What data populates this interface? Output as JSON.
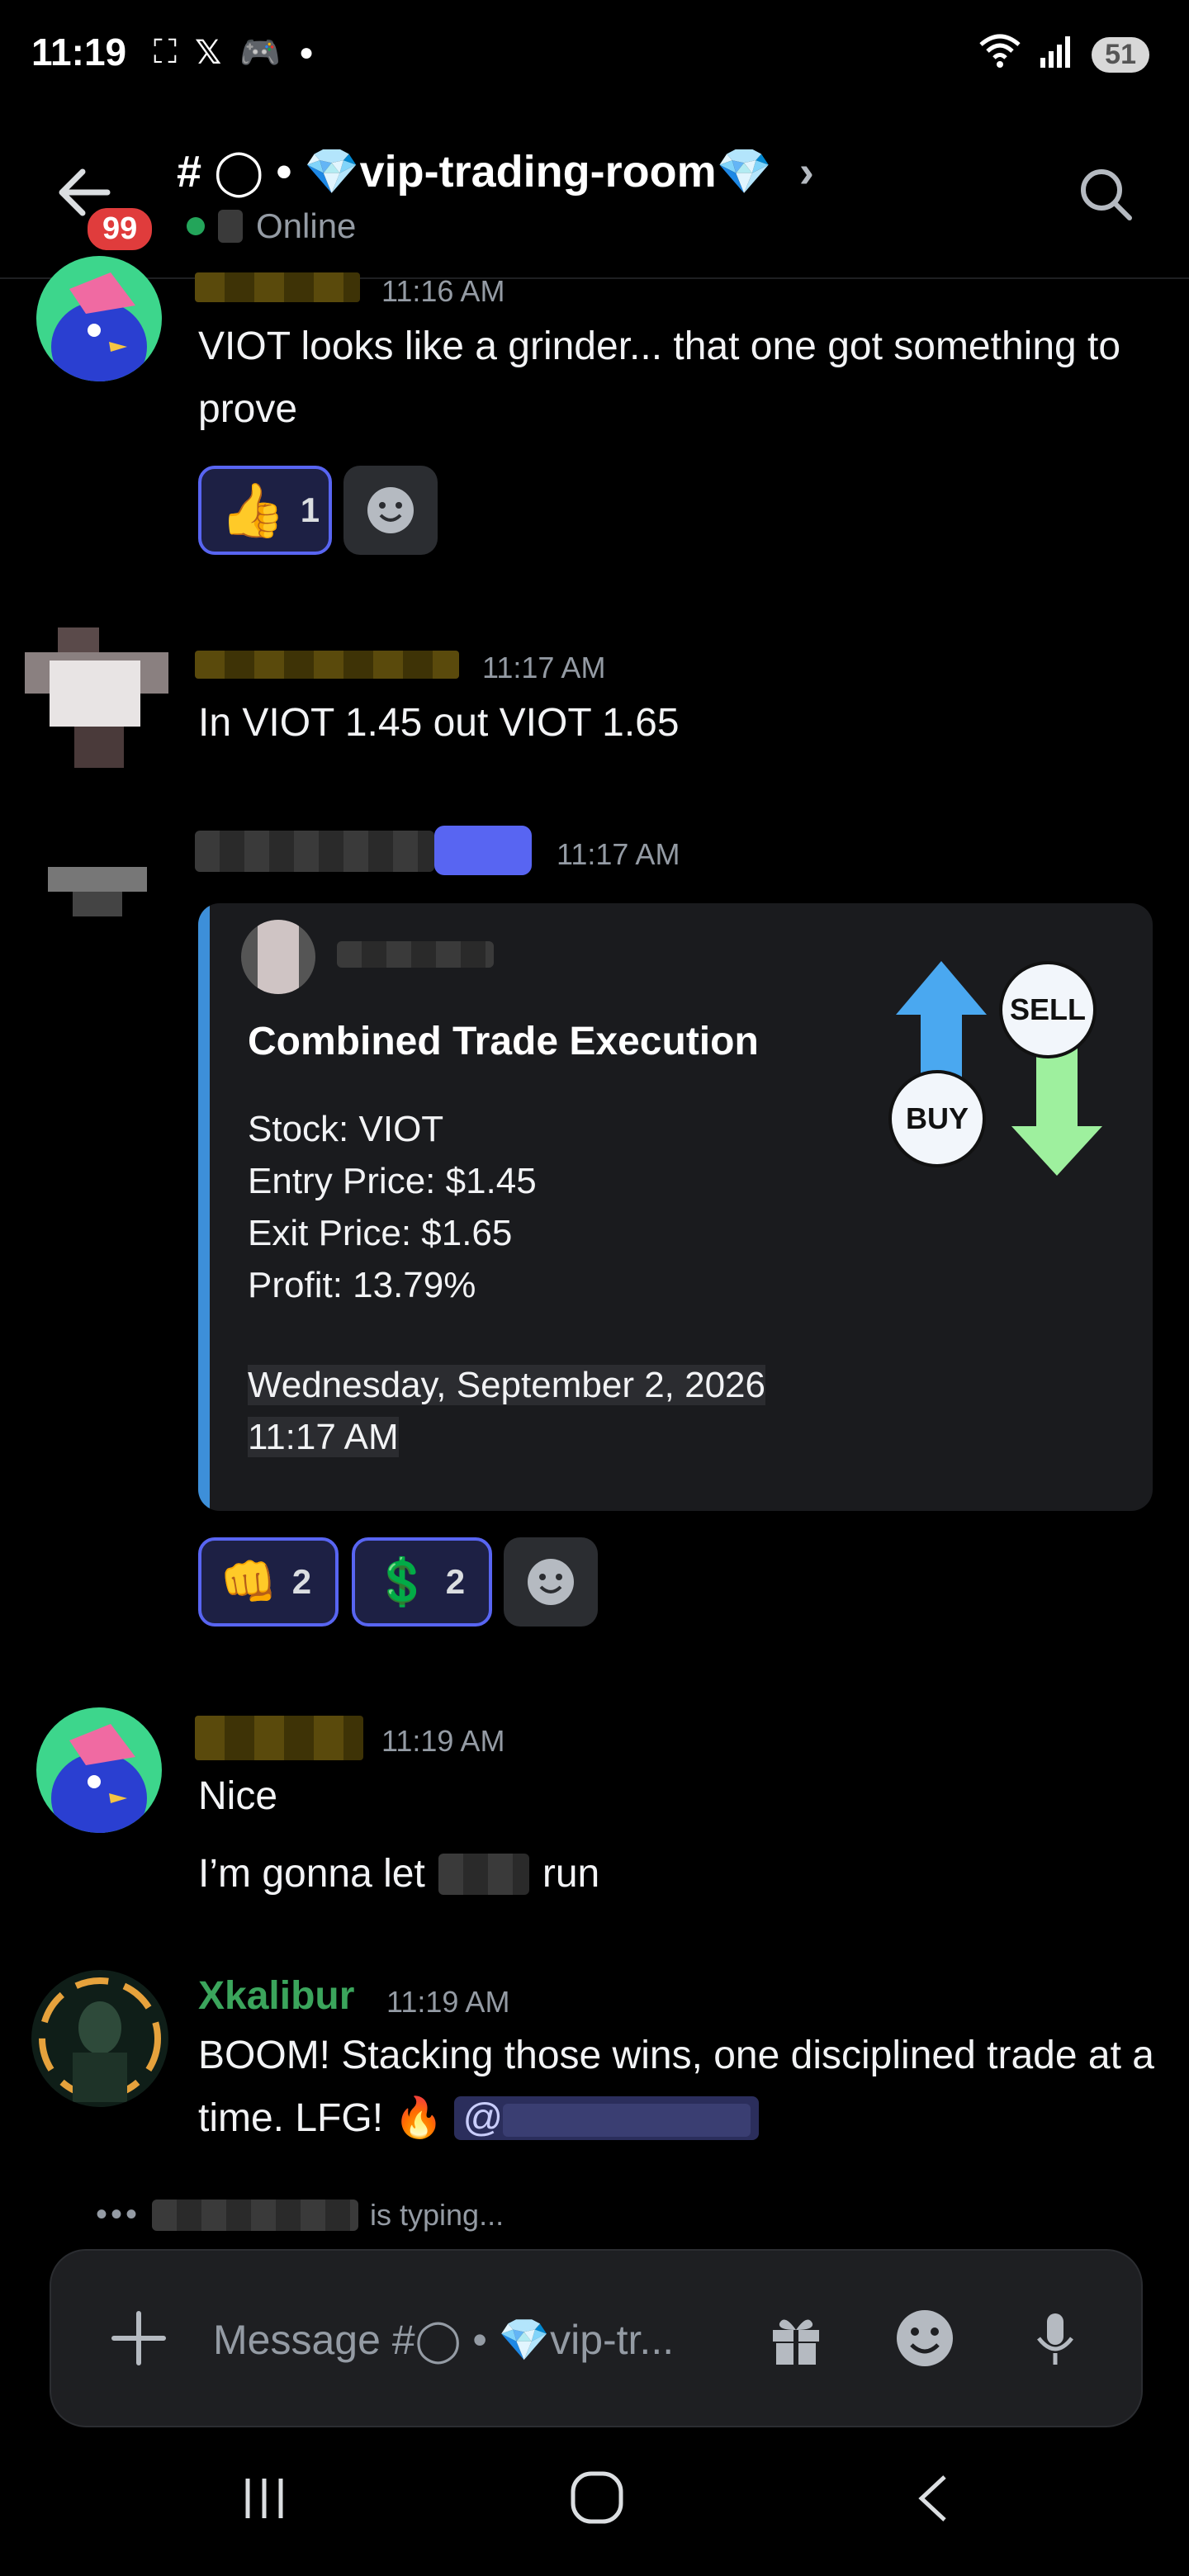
{
  "status_bar": {
    "time": "11:19",
    "battery": "51"
  },
  "header": {
    "unread_badge": "99",
    "channel_name": "# ◯ • 💎vip-trading-room💎",
    "chevron": "›",
    "status": "Online"
  },
  "messages": [
    {
      "timestamp": "11:16 AM",
      "text": "VIOT looks like a grinder... that one got something to prove",
      "reactions": [
        {
          "emoji": "👍",
          "count": "1"
        }
      ]
    },
    {
      "timestamp": "11:17 AM",
      "text": "In VIOT 1.45 out VIOT 1.65"
    },
    {
      "timestamp": "11:17 AM",
      "embed": {
        "title": "Combined Trade Execution",
        "lines": [
          "Stock: VIOT",
          "Entry Price: $1.45",
          "Exit Price: $1.65",
          "Profit: 13.79%"
        ],
        "date": "Wednesday, September 2, 2026",
        "time": "11:17 AM",
        "thumb_sell": "SELL",
        "thumb_buy": "BUY"
      },
      "reactions": [
        {
          "emoji": "👊",
          "count": "2"
        },
        {
          "emoji": "💲",
          "count": "2"
        }
      ]
    },
    {
      "timestamp": "11:19 AM",
      "line1": "Nice",
      "line2_start": "I’m gonna let",
      "line2_end": "run"
    },
    {
      "author": "Xkalibur",
      "timestamp": "11:19 AM",
      "text": "BOOM! Stacking those wins, one disciplined trade at a time. LFG! 🔥",
      "mention_at": "@"
    }
  ],
  "typing": {
    "dots": "•••",
    "suffix": "is typing..."
  },
  "composer": {
    "placeholder": "Message #◯ • 💎vip-tr..."
  },
  "colors": {
    "accent": "#5865f2",
    "online": "#23a55a",
    "embed_bar": "#3d8fd9",
    "username_green": "#3ba55c",
    "badge_red": "#e03c3c"
  }
}
